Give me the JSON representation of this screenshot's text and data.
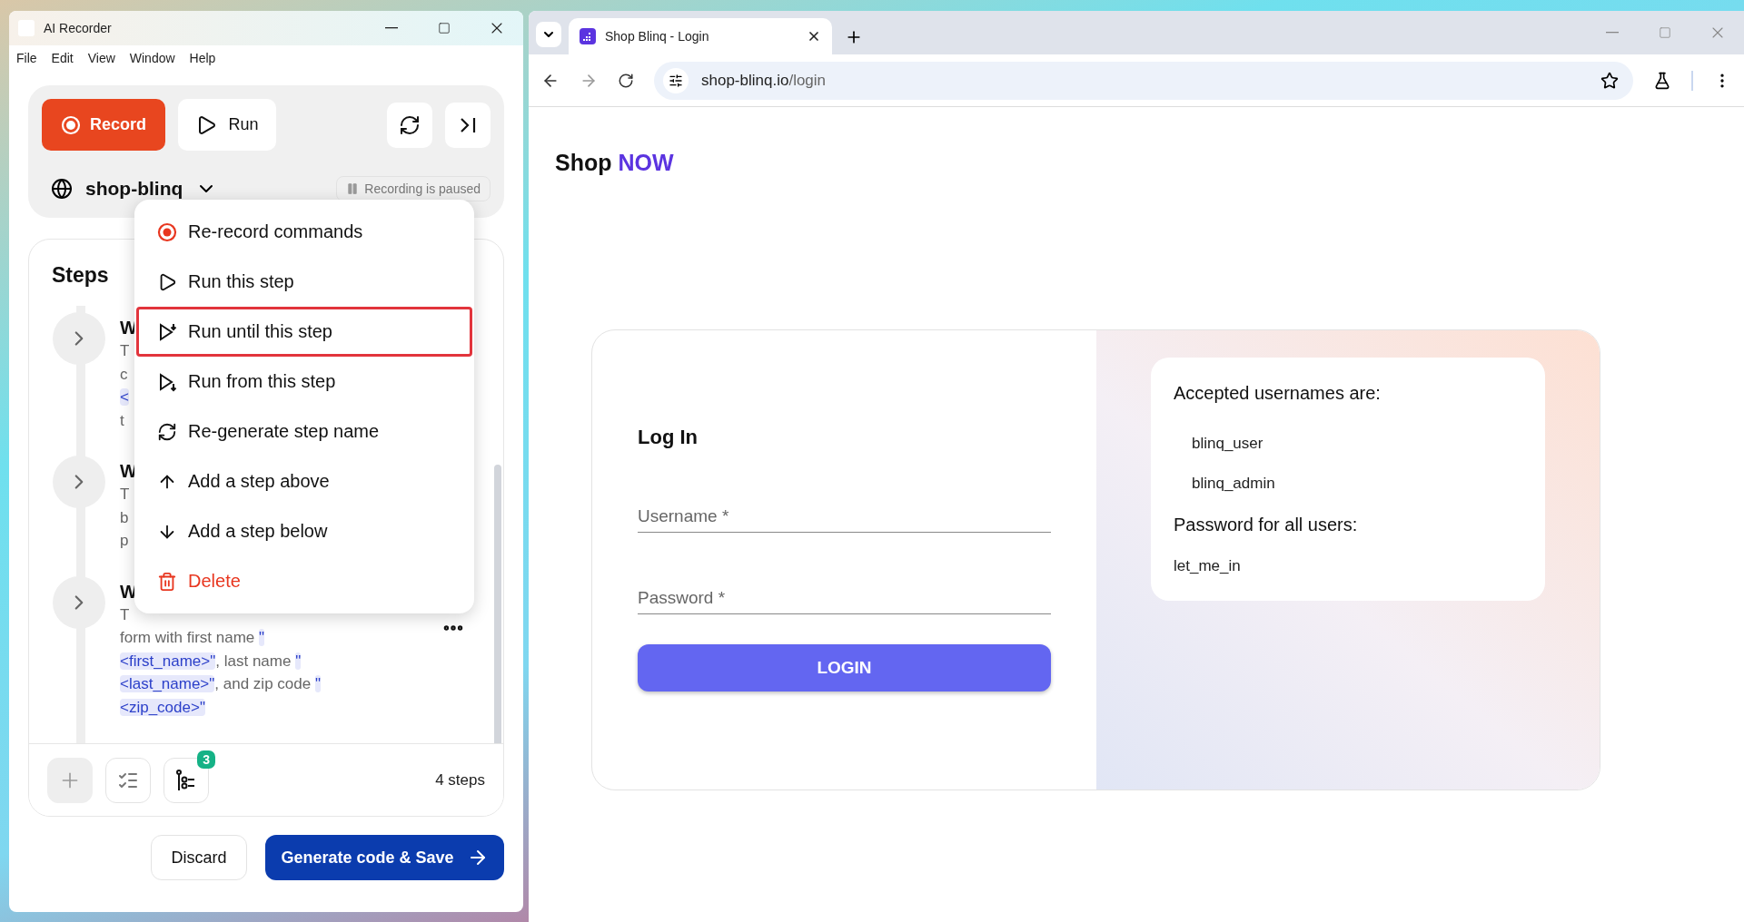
{
  "recorder": {
    "title": "AI Recorder",
    "menu": [
      "File",
      "Edit",
      "View",
      "Window",
      "Help"
    ],
    "record_button": "Record",
    "run_button": "Run",
    "site": "shop-blinq",
    "status": "Recording is paused",
    "steps_title": "Steps",
    "steps": [
      {
        "title": "W",
        "lines": [
          [
            {
              "text": "T",
              "kind": "text"
            }
          ],
          [
            {
              "text": "c",
              "kind": "text"
            }
          ],
          [
            {
              "text": "<",
              "kind": "variable"
            }
          ],
          [
            {
              "text": "t",
              "kind": "text"
            }
          ]
        ]
      },
      {
        "title": "W",
        "lines": [
          [
            {
              "text": "T",
              "kind": "text"
            }
          ],
          [
            {
              "text": "b",
              "kind": "text"
            }
          ],
          [
            {
              "text": "p",
              "kind": "text"
            }
          ]
        ]
      },
      {
        "title": "W",
        "lines": [
          [
            {
              "text": "T",
              "kind": "text"
            }
          ],
          [
            {
              "text": "form with first name ",
              "kind": "text"
            },
            {
              "text": "\"",
              "kind": "variable"
            }
          ],
          [
            {
              "text": "<first_name>\"",
              "kind": "variable"
            },
            {
              "text": ", last name ",
              "kind": "text"
            },
            {
              "text": "\"",
              "kind": "variable"
            }
          ],
          [
            {
              "text": "<last_name>\"",
              "kind": "variable"
            },
            {
              "text": ", and zip code ",
              "kind": "text"
            },
            {
              "text": "\"",
              "kind": "variable"
            }
          ],
          [
            {
              "text": "<zip_code>\"",
              "kind": "variable"
            }
          ]
        ],
        "more": true
      }
    ],
    "badge": "3",
    "step_count": "4 steps",
    "discard_button": "Discard",
    "save_button": "Generate code & Save",
    "context_menu": [
      {
        "label": "Re-record commands",
        "kind": "record",
        "selected": false
      },
      {
        "label": "Run this step",
        "kind": "play",
        "selected": false
      },
      {
        "label": "Run until this step",
        "kind": "play-until",
        "selected": true
      },
      {
        "label": "Run from this step",
        "kind": "play-from",
        "selected": false
      },
      {
        "label": "Re-generate step name",
        "kind": "regenerate",
        "selected": false
      },
      {
        "label": "Add a step above",
        "kind": "up",
        "selected": false
      },
      {
        "label": "Add a step below",
        "kind": "down",
        "selected": false
      },
      {
        "label": "Delete",
        "kind": "delete",
        "selected": false
      }
    ]
  },
  "browser": {
    "tabs": [
      {
        "label": "Shop Blinq - Login",
        "selected": true
      }
    ],
    "url_host": "shop-blinq.io",
    "url_path": "/login",
    "logo": "Shop",
    "logo_accent": "NOW",
    "login": {
      "title": "Log In",
      "username_placeholder": "Username *",
      "password_placeholder": "Password *",
      "button": "LOGIN"
    },
    "info": {
      "usernames_heading": "Accepted usernames are:",
      "usernames": [
        "blinq_user",
        "blinq_admin"
      ],
      "password_heading": "Password for all users:",
      "password": "let_me_in"
    }
  }
}
